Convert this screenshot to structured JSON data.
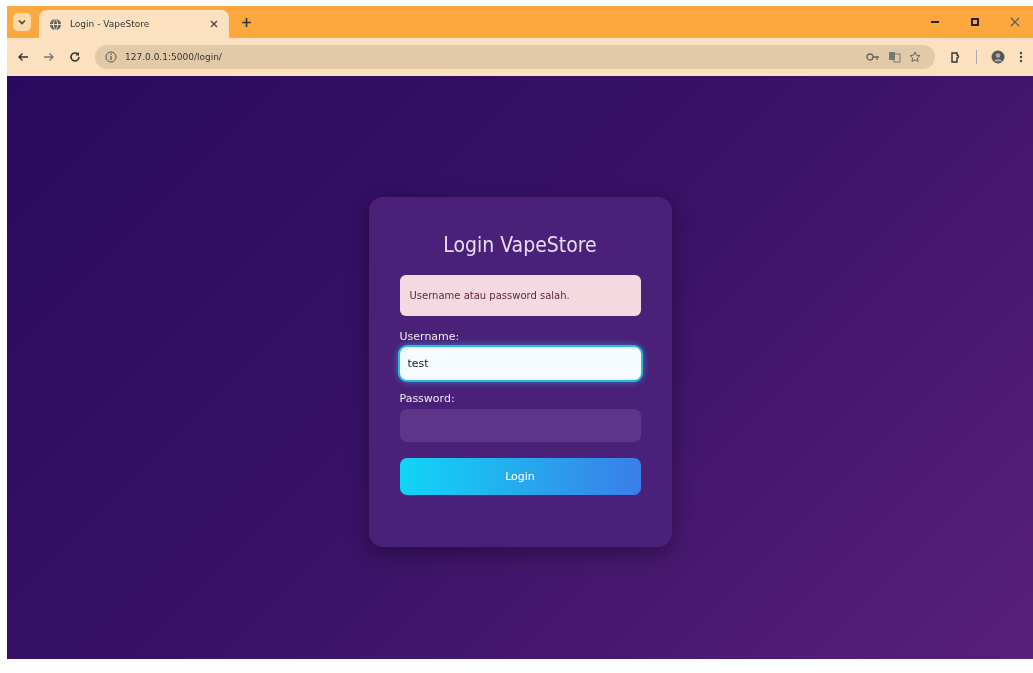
{
  "browser": {
    "tab_title": "Login - VapeStore",
    "address": "127.0.0.1:5000/login/"
  },
  "login": {
    "title": "Login VapeStore",
    "error": "Username atau password salah.",
    "fields": [
      {
        "label": "Username:",
        "value": "test",
        "focused": true
      },
      {
        "label": "Password:",
        "focused": false
      }
    ],
    "button": "Login"
  }
}
